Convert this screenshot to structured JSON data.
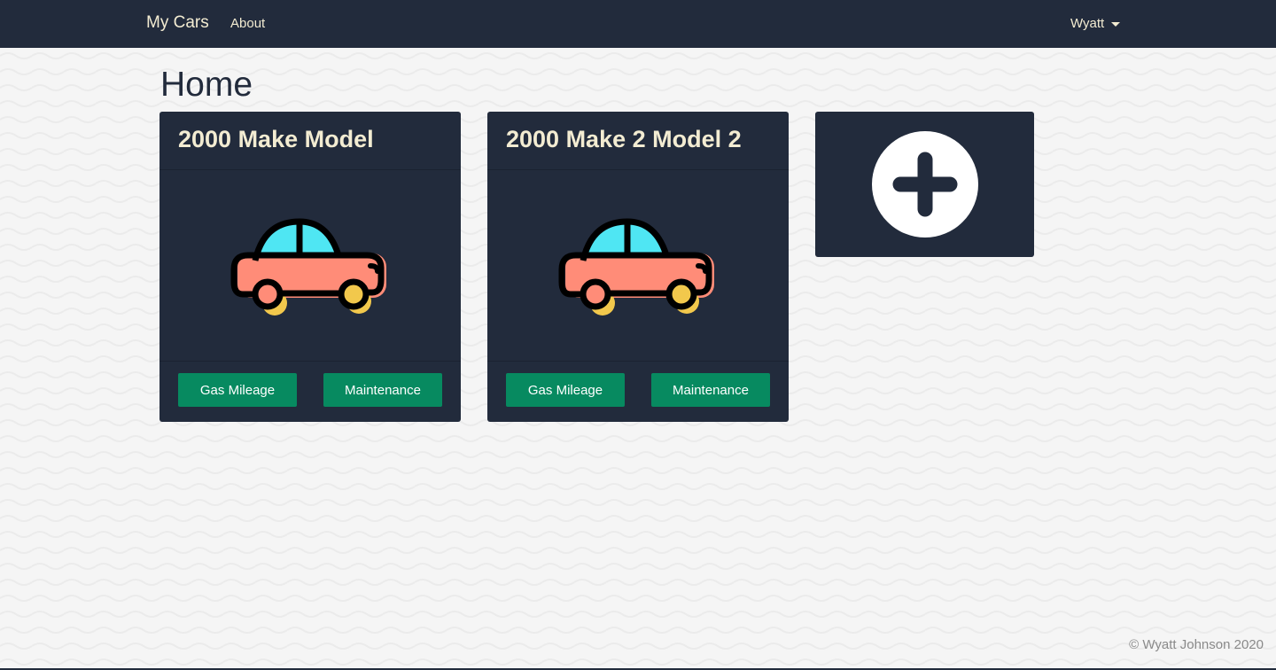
{
  "nav": {
    "brand": "My Cars",
    "about": "About",
    "user": "Wyatt"
  },
  "page": {
    "title": "Home"
  },
  "cars": [
    {
      "title": "2000 Make Model",
      "gas_label": "Gas Mileage",
      "maintenance_label": "Maintenance"
    },
    {
      "title": "2000 Make 2 Model 2",
      "gas_label": "Gas Mileage",
      "maintenance_label": "Maintenance"
    }
  ],
  "add_card": {
    "icon": "plus-circle-icon"
  },
  "footer": {
    "copyright": "© Wyatt Johnson 2020"
  },
  "colors": {
    "navbar": "#222b3c",
    "card": "#222b3c",
    "accent_text": "#f3ecd2",
    "button": "#078a60",
    "car_body": "#ff8c78",
    "car_window": "#4fe6f3",
    "car_wheel": "#f2c84c"
  }
}
